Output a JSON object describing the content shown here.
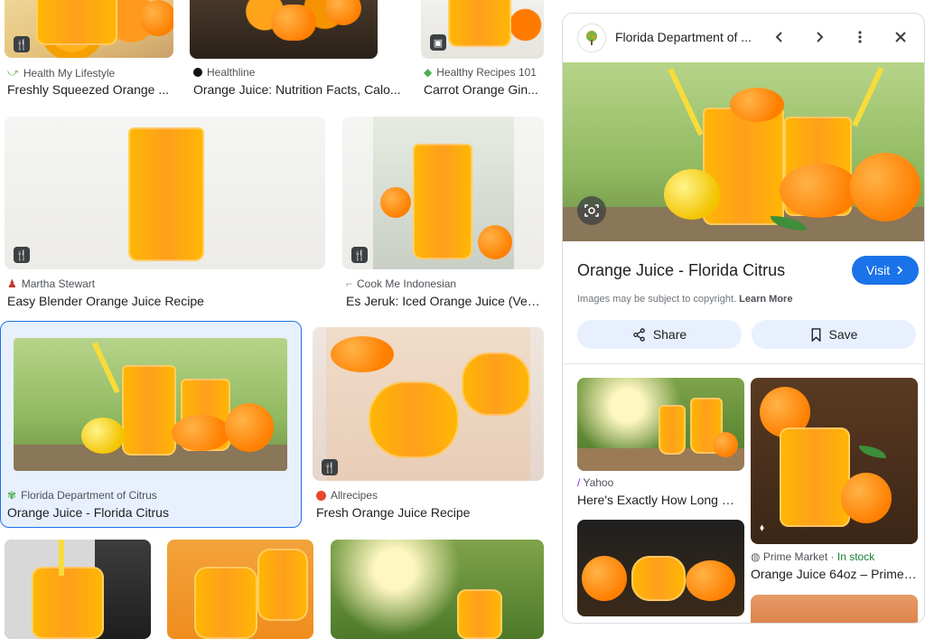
{
  "grid": {
    "row1": [
      {
        "source": "Health My Lifestyle",
        "title": "Freshly Squeezed Orange ...",
        "badge": "🍴"
      },
      {
        "source": "Healthline",
        "title": "Orange Juice: Nutrition Facts, Calo..."
      },
      {
        "source": "Healthy Recipes 101",
        "title": "Carrot Orange Gin...",
        "badge": "▣"
      }
    ],
    "row2": [
      {
        "source": "Martha Stewart",
        "title": "Easy Blender Orange Juice Recipe",
        "badge": "🍴"
      },
      {
        "source": "Cook Me Indonesian",
        "title": "Es Jeruk: Iced Orange Juice (Veg...",
        "badge": "🍴"
      }
    ],
    "row3": [
      {
        "source": "Florida Department of Citrus",
        "title": "Orange Juice - Florida Citrus"
      },
      {
        "source": "Allrecipes",
        "title": "Fresh Orange Juice Recipe",
        "badge": "🍴"
      }
    ]
  },
  "panel": {
    "site_name": "Florida Department of ...",
    "title": "Orange Juice - Florida Citrus",
    "visit_label": "Visit",
    "copyright_text": "Images may be subject to copyright.",
    "learn_more": "Learn More",
    "share_label": "Share",
    "save_label": "Save",
    "related": [
      {
        "source": "Yahoo",
        "title": "Here's Exactly How Long O..."
      },
      {
        "source": "Prime Market",
        "stock": "In stock",
        "title": "Orange Juice 64oz – Prime ..."
      }
    ]
  },
  "colors": {
    "accent": "#1a73e8",
    "stock_green": "#188038",
    "selected_bg": "#e8f0fe"
  }
}
